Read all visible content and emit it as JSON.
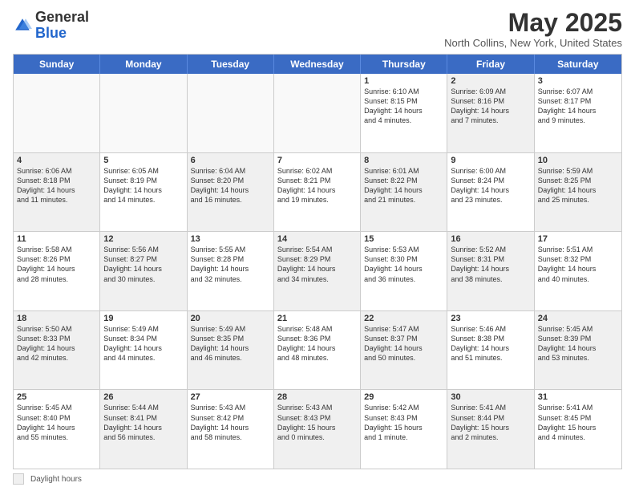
{
  "header": {
    "logo_general": "General",
    "logo_blue": "Blue",
    "month_title": "May 2025",
    "location": "North Collins, New York, United States"
  },
  "days_of_week": [
    "Sunday",
    "Monday",
    "Tuesday",
    "Wednesday",
    "Thursday",
    "Friday",
    "Saturday"
  ],
  "weeks": [
    [
      {
        "day": "",
        "empty": true
      },
      {
        "day": "",
        "empty": true
      },
      {
        "day": "",
        "empty": true
      },
      {
        "day": "",
        "empty": true
      },
      {
        "day": "1",
        "info": "Sunrise: 6:10 AM\nSunset: 8:15 PM\nDaylight: 14 hours\nand 4 minutes."
      },
      {
        "day": "2",
        "info": "Sunrise: 6:09 AM\nSunset: 8:16 PM\nDaylight: 14 hours\nand 7 minutes.",
        "shaded": true
      },
      {
        "day": "3",
        "info": "Sunrise: 6:07 AM\nSunset: 8:17 PM\nDaylight: 14 hours\nand 9 minutes."
      }
    ],
    [
      {
        "day": "4",
        "info": "Sunrise: 6:06 AM\nSunset: 8:18 PM\nDaylight: 14 hours\nand 11 minutes.",
        "shaded": true
      },
      {
        "day": "5",
        "info": "Sunrise: 6:05 AM\nSunset: 8:19 PM\nDaylight: 14 hours\nand 14 minutes."
      },
      {
        "day": "6",
        "info": "Sunrise: 6:04 AM\nSunset: 8:20 PM\nDaylight: 14 hours\nand 16 minutes.",
        "shaded": true
      },
      {
        "day": "7",
        "info": "Sunrise: 6:02 AM\nSunset: 8:21 PM\nDaylight: 14 hours\nand 19 minutes."
      },
      {
        "day": "8",
        "info": "Sunrise: 6:01 AM\nSunset: 8:22 PM\nDaylight: 14 hours\nand 21 minutes.",
        "shaded": true
      },
      {
        "day": "9",
        "info": "Sunrise: 6:00 AM\nSunset: 8:24 PM\nDaylight: 14 hours\nand 23 minutes."
      },
      {
        "day": "10",
        "info": "Sunrise: 5:59 AM\nSunset: 8:25 PM\nDaylight: 14 hours\nand 25 minutes.",
        "shaded": true
      }
    ],
    [
      {
        "day": "11",
        "info": "Sunrise: 5:58 AM\nSunset: 8:26 PM\nDaylight: 14 hours\nand 28 minutes."
      },
      {
        "day": "12",
        "info": "Sunrise: 5:56 AM\nSunset: 8:27 PM\nDaylight: 14 hours\nand 30 minutes.",
        "shaded": true
      },
      {
        "day": "13",
        "info": "Sunrise: 5:55 AM\nSunset: 8:28 PM\nDaylight: 14 hours\nand 32 minutes."
      },
      {
        "day": "14",
        "info": "Sunrise: 5:54 AM\nSunset: 8:29 PM\nDaylight: 14 hours\nand 34 minutes.",
        "shaded": true
      },
      {
        "day": "15",
        "info": "Sunrise: 5:53 AM\nSunset: 8:30 PM\nDaylight: 14 hours\nand 36 minutes."
      },
      {
        "day": "16",
        "info": "Sunrise: 5:52 AM\nSunset: 8:31 PM\nDaylight: 14 hours\nand 38 minutes.",
        "shaded": true
      },
      {
        "day": "17",
        "info": "Sunrise: 5:51 AM\nSunset: 8:32 PM\nDaylight: 14 hours\nand 40 minutes."
      }
    ],
    [
      {
        "day": "18",
        "info": "Sunrise: 5:50 AM\nSunset: 8:33 PM\nDaylight: 14 hours\nand 42 minutes.",
        "shaded": true
      },
      {
        "day": "19",
        "info": "Sunrise: 5:49 AM\nSunset: 8:34 PM\nDaylight: 14 hours\nand 44 minutes."
      },
      {
        "day": "20",
        "info": "Sunrise: 5:49 AM\nSunset: 8:35 PM\nDaylight: 14 hours\nand 46 minutes.",
        "shaded": true
      },
      {
        "day": "21",
        "info": "Sunrise: 5:48 AM\nSunset: 8:36 PM\nDaylight: 14 hours\nand 48 minutes."
      },
      {
        "day": "22",
        "info": "Sunrise: 5:47 AM\nSunset: 8:37 PM\nDaylight: 14 hours\nand 50 minutes.",
        "shaded": true
      },
      {
        "day": "23",
        "info": "Sunrise: 5:46 AM\nSunset: 8:38 PM\nDaylight: 14 hours\nand 51 minutes."
      },
      {
        "day": "24",
        "info": "Sunrise: 5:45 AM\nSunset: 8:39 PM\nDaylight: 14 hours\nand 53 minutes.",
        "shaded": true
      }
    ],
    [
      {
        "day": "25",
        "info": "Sunrise: 5:45 AM\nSunset: 8:40 PM\nDaylight: 14 hours\nand 55 minutes."
      },
      {
        "day": "26",
        "info": "Sunrise: 5:44 AM\nSunset: 8:41 PM\nDaylight: 14 hours\nand 56 minutes.",
        "shaded": true
      },
      {
        "day": "27",
        "info": "Sunrise: 5:43 AM\nSunset: 8:42 PM\nDaylight: 14 hours\nand 58 minutes."
      },
      {
        "day": "28",
        "info": "Sunrise: 5:43 AM\nSunset: 8:43 PM\nDaylight: 15 hours\nand 0 minutes.",
        "shaded": true
      },
      {
        "day": "29",
        "info": "Sunrise: 5:42 AM\nSunset: 8:43 PM\nDaylight: 15 hours\nand 1 minute."
      },
      {
        "day": "30",
        "info": "Sunrise: 5:41 AM\nSunset: 8:44 PM\nDaylight: 15 hours\nand 2 minutes.",
        "shaded": true
      },
      {
        "day": "31",
        "info": "Sunrise: 5:41 AM\nSunset: 8:45 PM\nDaylight: 15 hours\nand 4 minutes."
      }
    ]
  ],
  "footer": {
    "shaded_label": "Daylight hours"
  }
}
